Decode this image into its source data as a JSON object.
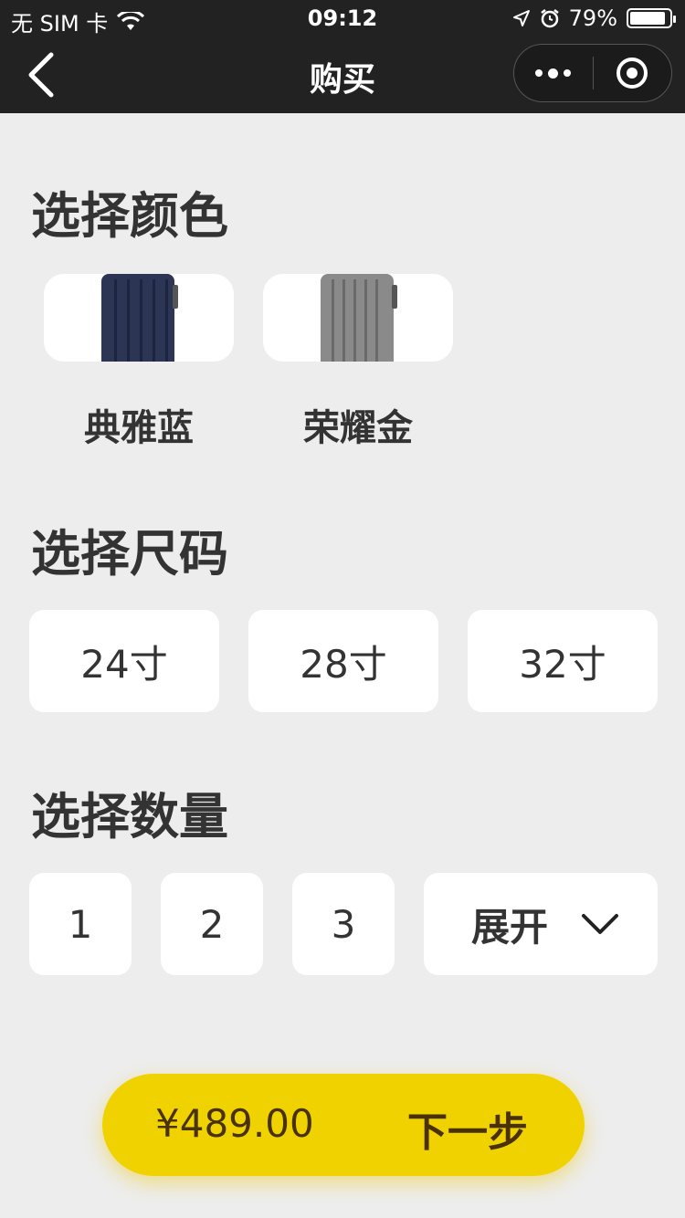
{
  "status_bar": {
    "carrier": "无 SIM 卡",
    "time": "09:12",
    "battery_percent": "79%",
    "battery_level": 0.79,
    "icons": [
      "wifi-icon",
      "location-icon",
      "alarm-icon",
      "battery-icon"
    ]
  },
  "nav": {
    "title": "购买",
    "back_icon": "chevron-left-icon",
    "more_icon": "more-dots-icon",
    "close_icon": "target-icon"
  },
  "color_section": {
    "title": "选择颜色",
    "options": [
      {
        "label": "典雅蓝",
        "swatch": "#2c3654"
      },
      {
        "label": "荣耀金",
        "swatch": "#8a8a8a"
      }
    ]
  },
  "size_section": {
    "title": "选择尺码",
    "options": [
      "24寸",
      "28寸",
      "32寸"
    ]
  },
  "quantity_section": {
    "title": "选择数量",
    "options": [
      "1",
      "2",
      "3"
    ],
    "expand_label": "展开"
  },
  "checkout": {
    "price": "¥489.00",
    "next_label": "下一步",
    "accent": "#f0d200"
  }
}
